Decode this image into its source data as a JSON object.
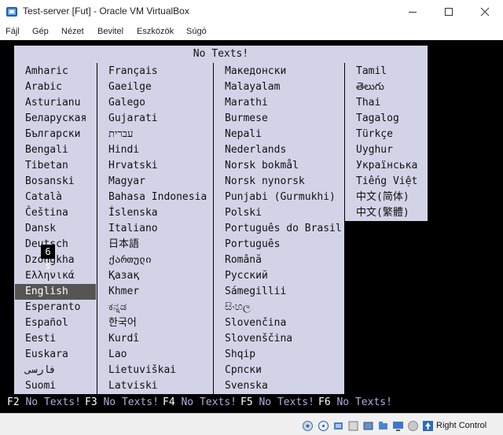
{
  "window": {
    "title": "Test-server [Fut] - Oracle VM VirtualBox"
  },
  "menu": {
    "items": [
      "Fájl",
      "Gép",
      "Nézet",
      "Bevitel",
      "Eszközök",
      "Súgó"
    ]
  },
  "dialog": {
    "title": "No Texts!",
    "timer": "6 s",
    "selected_language": "English",
    "columns": [
      [
        "Amharic",
        "Arabic",
        "Asturianu",
        "Беларуская",
        "Български",
        "Bengali",
        "Tibetan",
        "Bosanski",
        "Català",
        "Čeština",
        "Dansk",
        "Deutsch",
        "Dzongkha",
        "Ελληνικά",
        "English",
        "Esperanto",
        "Español",
        "Eesti",
        "Euskara",
        "فارسی",
        "Suomi"
      ],
      [
        "Français",
        "Gaeilge",
        "Galego",
        "Gujarati",
        "עברית",
        "Hindi",
        "Hrvatski",
        "Magyar",
        "Bahasa Indonesia",
        "Íslenska",
        "Italiano",
        "日本語",
        "ქართული",
        "Қазақ",
        "Khmer",
        "ಕನ್ನಡ",
        "한국어",
        "Kurdî",
        "Lao",
        "Lietuviškai",
        "Latviski"
      ],
      [
        "Македонски",
        "Malayalam",
        "Marathi",
        "Burmese",
        "Nepali",
        "Nederlands",
        "Norsk bokmål",
        "Norsk nynorsk",
        "Punjabi (Gurmukhi)",
        "Polski",
        "Português do Brasil",
        "Português",
        "Română",
        "Русский",
        "Sámegillii",
        "සිංහල",
        "Slovenčina",
        "Slovenščina",
        "Shqip",
        "Српски",
        "Svenska"
      ],
      [
        "Tamil",
        "తెలుగు",
        "Thai",
        "Tagalog",
        "Türkçe",
        "Uyghur",
        "Українська",
        "Tiếng Việt",
        "中文(简体)",
        "中文(繁體)"
      ]
    ]
  },
  "fkeys": [
    {
      "key": "F2",
      "label": "No Texts!"
    },
    {
      "key": "F3",
      "label": "No Texts!"
    },
    {
      "key": "F4",
      "label": "No Texts!"
    },
    {
      "key": "F5",
      "label": "No Texts!"
    },
    {
      "key": "F6",
      "label": "No Texts!"
    }
  ],
  "statusbar": {
    "host_key": "Right Control",
    "icons": [
      "hard-disk-icon",
      "optical-drive-icon",
      "audio-icon",
      "network-icon",
      "usb-icon",
      "shared-folders-icon",
      "display-icon",
      "video-capture-icon",
      "mouse-integration-icon",
      "cpu-icon",
      "host-key-arrow-icon"
    ]
  },
  "colors": {
    "dialog_bg": "#d3d3e7",
    "selected_bg": "#555555",
    "fkey_label": "#aab0dd"
  }
}
